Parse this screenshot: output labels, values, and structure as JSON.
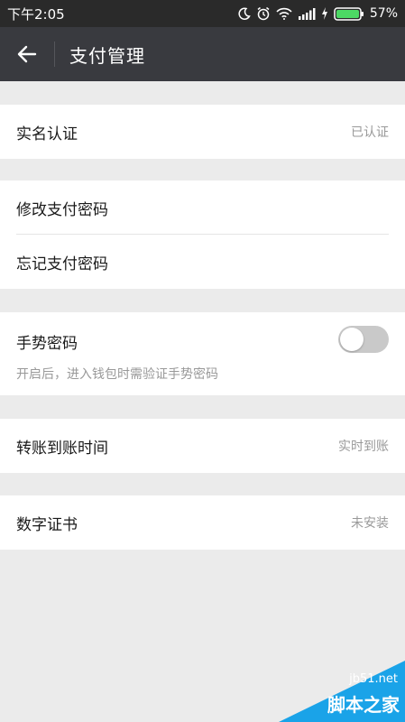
{
  "status_bar": {
    "time": "下午2:05",
    "battery_percent": "57%",
    "icons": [
      "moon-icon",
      "alarm-icon",
      "wifi-icon",
      "signal-icon",
      "charging-icon",
      "battery-icon"
    ]
  },
  "toolbar": {
    "back_icon": "arrow-left-icon",
    "title": "支付管理"
  },
  "sections": {
    "identity": {
      "label": "实名认证",
      "value": "已认证"
    },
    "password": {
      "modify_label": "修改支付密码",
      "forgot_label": "忘记支付密码"
    },
    "gesture": {
      "label": "手势密码",
      "description": "开启后，进入钱包时需验证手势密码",
      "toggle_on": false
    },
    "transfer": {
      "label": "转账到账时间",
      "value": "实时到账"
    },
    "certificate": {
      "label": "数字证书",
      "value": "未安装"
    }
  },
  "watermark": {
    "site": "jb51.net",
    "name": "脚本之家"
  },
  "colors": {
    "toolbar": "#393a3f",
    "status_bar": "#2a2a2a",
    "background": "#ebebeb",
    "secondary_text": "#999999",
    "watermark": "#1aa3e8"
  }
}
